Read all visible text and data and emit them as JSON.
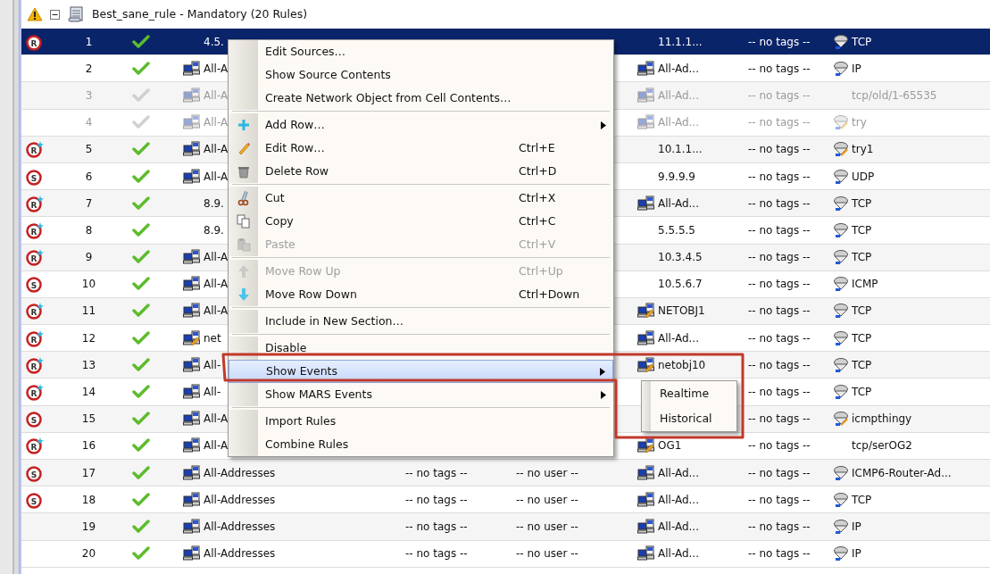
{
  "header": {
    "title": "Best_sane_rule - Mandatory (20 Rules)",
    "expanded": true
  },
  "rows": [
    {
      "number": "1",
      "selected": true,
      "disabled": false,
      "action": {
        "letter": "R",
        "star": false
      },
      "source": {
        "text": "4.5."
      },
      "destination": {
        "text": "11.1.1..."
      },
      "destination_tags": "-- no tags --",
      "service": {
        "kind": "service",
        "text": "TCP"
      }
    },
    {
      "number": "2",
      "selected": false,
      "disabled": false,
      "source": {
        "kind": "network",
        "text": "All-A"
      },
      "destination": {
        "kind": "network",
        "text": "All-Ad..."
      },
      "destination_tags": "-- no tags --",
      "service": {
        "kind": "service",
        "text": "IP"
      }
    },
    {
      "number": "3",
      "selected": false,
      "disabled": true,
      "source": {
        "kind": "network",
        "text": "All-A"
      },
      "destination": {
        "kind": "network",
        "text": "All-Ad..."
      },
      "destination_tags": "-- no tags --",
      "service": {
        "text": "tcp/old/1-65535"
      }
    },
    {
      "number": "4",
      "selected": false,
      "disabled": true,
      "source": {
        "kind": "network",
        "text": "All-A"
      },
      "destination": {
        "kind": "network",
        "text": "All-Ad..."
      },
      "destination_tags": "-- no tags --",
      "service": {
        "kind": "service_edit",
        "text": "try"
      }
    },
    {
      "number": "5",
      "selected": false,
      "disabled": false,
      "action": {
        "letter": "R",
        "star": true
      },
      "source": {
        "kind": "network",
        "text": "All-A"
      },
      "destination": {
        "text": "10.1.1..."
      },
      "destination_tags": "-- no tags --",
      "service": {
        "kind": "service_edit",
        "text": "try1"
      }
    },
    {
      "number": "6",
      "selected": false,
      "disabled": false,
      "action": {
        "letter": "S",
        "star": false
      },
      "source": {
        "kind": "network",
        "text": "All-A"
      },
      "destination": {
        "text": "9.9.9.9"
      },
      "destination_tags": "-- no tags --",
      "service": {
        "kind": "service",
        "text": "UDP"
      }
    },
    {
      "number": "7",
      "selected": false,
      "disabled": false,
      "action": {
        "letter": "R",
        "star": true
      },
      "source": {
        "text": "8.9."
      },
      "destination": {
        "kind": "network",
        "text": "All-Ad..."
      },
      "destination_tags": "-- no tags --",
      "service": {
        "kind": "service",
        "text": "TCP"
      }
    },
    {
      "number": "8",
      "selected": false,
      "disabled": false,
      "action": {
        "letter": "R",
        "star": true
      },
      "source": {
        "text": "8.9."
      },
      "destination": {
        "text": "5.5.5.5"
      },
      "destination_tags": "-- no tags --",
      "service": {
        "kind": "service",
        "text": "TCP"
      }
    },
    {
      "number": "9",
      "selected": false,
      "disabled": false,
      "action": {
        "letter": "R",
        "star": true
      },
      "source": {
        "kind": "network",
        "text": "All-A"
      },
      "destination": {
        "text": "10.3.4.5"
      },
      "destination_tags": "-- no tags --",
      "service": {
        "kind": "service",
        "text": "TCP"
      }
    },
    {
      "number": "10",
      "selected": false,
      "disabled": false,
      "action": {
        "letter": "S",
        "star": false
      },
      "source": {
        "kind": "network",
        "text": "All-A"
      },
      "destination": {
        "text": "10.5.6.7"
      },
      "destination_tags": "-- no tags --",
      "service": {
        "kind": "service",
        "text": "ICMP"
      }
    },
    {
      "number": "11",
      "selected": false,
      "disabled": false,
      "action": {
        "letter": "R",
        "star": true
      },
      "source": {
        "kind": "network",
        "text": "All-A"
      },
      "destination": {
        "kind": "network_edit",
        "text": "NETOBJ1"
      },
      "destination_tags": "-- no tags --",
      "service": {
        "kind": "service",
        "text": "TCP"
      }
    },
    {
      "number": "12",
      "selected": false,
      "disabled": false,
      "action": {
        "letter": "R",
        "star": true
      },
      "source": {
        "kind": "network_edit",
        "text": "net"
      },
      "destination": {
        "kind": "network",
        "text": "All-Ad..."
      },
      "destination_tags": "-- no tags --",
      "service": {
        "kind": "service",
        "text": "TCP"
      }
    },
    {
      "number": "13",
      "selected": false,
      "disabled": false,
      "action": {
        "letter": "R",
        "star": true
      },
      "source": {
        "kind": "network",
        "text": "All-"
      },
      "destination": {
        "kind": "network_edit",
        "text": "netobj10"
      },
      "destination_tags": "-- no tags --",
      "service": {
        "kind": "service",
        "text": "TCP"
      }
    },
    {
      "number": "14",
      "selected": false,
      "disabled": false,
      "action": {
        "letter": "R",
        "star": true
      },
      "source": {
        "kind": "network",
        "text": "All-"
      },
      "destination_tags": "-- no tags --",
      "service": {
        "kind": "service",
        "text": "TCP"
      }
    },
    {
      "number": "15",
      "selected": false,
      "disabled": false,
      "action": {
        "letter": "S",
        "star": false
      },
      "source": {
        "kind": "network",
        "text": "All-A"
      },
      "destination_tags": "-- no tags --",
      "service": {
        "kind": "service_edit",
        "text": "icmpthingy"
      }
    },
    {
      "number": "16",
      "selected": false,
      "disabled": false,
      "action": {
        "letter": "R",
        "star": true
      },
      "source": {
        "kind": "network",
        "text": "All-A"
      },
      "destination": {
        "kind": "network_edit",
        "text": "OG1"
      },
      "destination_tags": "-- no tags --",
      "service": {
        "text": "tcp/serOG2"
      }
    },
    {
      "number": "17",
      "selected": false,
      "disabled": false,
      "action": {
        "letter": "S",
        "star": false
      },
      "source": {
        "kind": "network",
        "text": "All-Addresses"
      },
      "tags": "-- no tags --",
      "user": "-- no user --",
      "destination": {
        "kind": "network",
        "text": "All-Ad..."
      },
      "destination_tags": "-- no tags --",
      "service": {
        "kind": "service",
        "text": "ICMP6-Router-Ad..."
      }
    },
    {
      "number": "18",
      "selected": false,
      "disabled": false,
      "action": {
        "letter": "S",
        "star": false
      },
      "source": {
        "kind": "network",
        "text": "All-Addresses"
      },
      "tags": "-- no tags --",
      "user": "-- no user --",
      "destination": {
        "kind": "network",
        "text": "All-Ad..."
      },
      "destination_tags": "-- no tags --",
      "service": {
        "kind": "service",
        "text": "TCP"
      }
    },
    {
      "number": "19",
      "selected": false,
      "disabled": false,
      "source": {
        "kind": "network",
        "text": "All-Addresses"
      },
      "tags": "-- no tags --",
      "user": "-- no user --",
      "destination": {
        "kind": "network",
        "text": "All-Ad..."
      },
      "destination_tags": "-- no tags --",
      "service": {
        "kind": "service",
        "text": "IP"
      }
    },
    {
      "number": "20",
      "selected": false,
      "disabled": false,
      "source": {
        "kind": "network",
        "text": "All-Addresses"
      },
      "tags": "-- no tags --",
      "user": "-- no user --",
      "destination": {
        "kind": "network",
        "text": "All-Ad..."
      },
      "destination_tags": "-- no tags --",
      "service": {
        "kind": "service",
        "text": "IP"
      }
    }
  ],
  "context_menu": {
    "items": [
      {
        "kind": "item",
        "label": "Edit Sources…",
        "disabled": false,
        "selected": false
      },
      {
        "kind": "item",
        "label": "Show Source Contents",
        "disabled": false,
        "selected": false
      },
      {
        "kind": "item",
        "label": "Create Network Object from Cell Contents…",
        "disabled": false,
        "selected": false
      },
      {
        "kind": "separator"
      },
      {
        "kind": "plus",
        "label": "Add Row…",
        "submenu": true,
        "disabled": false,
        "selected": false
      },
      {
        "kind": "pencil",
        "label": "Edit Row…",
        "shortcut": "Ctrl+E",
        "disabled": false,
        "selected": false
      },
      {
        "kind": "trash",
        "label": "Delete Row",
        "shortcut": "Ctrl+D",
        "disabled": false,
        "selected": false
      },
      {
        "kind": "separator"
      },
      {
        "kind": "scissors",
        "label": "Cut",
        "shortcut": "Ctrl+X",
        "disabled": false,
        "selected": false
      },
      {
        "kind": "copy",
        "label": "Copy",
        "shortcut": "Ctrl+C",
        "disabled": false,
        "selected": false
      },
      {
        "kind": "paste",
        "label": "Paste",
        "shortcut": "Ctrl+V",
        "disabled": true,
        "selected": false
      },
      {
        "kind": "separator"
      },
      {
        "kind": "up",
        "label": "Move Row Up",
        "shortcut": "Ctrl+Up",
        "disabled": true,
        "selected": false
      },
      {
        "kind": "down",
        "label": "Move Row Down",
        "shortcut": "Ctrl+Down",
        "disabled": false,
        "selected": false
      },
      {
        "kind": "separator"
      },
      {
        "kind": "item",
        "label": "Include in New Section…",
        "disabled": false,
        "selected": false
      },
      {
        "kind": "separator"
      },
      {
        "kind": "item",
        "label": "Disable",
        "disabled": false,
        "selected": false
      },
      {
        "kind": "item",
        "label": "Show Events",
        "submenu": true,
        "disabled": false,
        "selected": true
      },
      {
        "kind": "item",
        "label": "Show MARS Events",
        "submenu": true,
        "disabled": false,
        "selected": false
      },
      {
        "kind": "separator"
      },
      {
        "kind": "item",
        "label": "Import Rules",
        "disabled": false,
        "selected": false
      },
      {
        "kind": "item",
        "label": "Combine Rules",
        "disabled": false,
        "selected": false
      }
    ]
  },
  "submenu": {
    "items": [
      {
        "label": "Realtime"
      },
      {
        "label": "Historical"
      }
    ]
  }
}
